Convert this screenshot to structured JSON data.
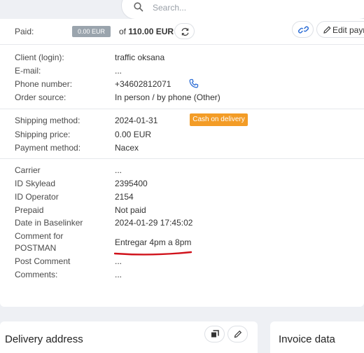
{
  "search": {
    "placeholder": "Search..."
  },
  "payment": {
    "label": "Paid:",
    "paid_amount": "0.00 EUR",
    "of_text": "of",
    "total": "110.00 EUR"
  },
  "actions": {
    "edit_label": "Edit payment"
  },
  "client": {
    "rows": [
      {
        "label": "Client (login):",
        "value": "traffic oksana"
      },
      {
        "label": "E-mail:",
        "value": "..."
      },
      {
        "label": "Phone number:",
        "value": "+34602812071"
      },
      {
        "label": "Order source:",
        "value": "In person / by phone (Other)"
      }
    ]
  },
  "shipping": {
    "rows": [
      {
        "label": "Shipping method:",
        "value": "2024-01-31"
      },
      {
        "label": "Shipping price:",
        "value": "0.00 EUR"
      },
      {
        "label": "Payment method:",
        "value": "Nacex"
      }
    ],
    "badge": "Cash on delivery"
  },
  "details": {
    "rows": [
      {
        "label": "Carrier",
        "value": "..."
      },
      {
        "label": "ID Skylead",
        "value": "2395400"
      },
      {
        "label": "ID Operator",
        "value": "2154"
      },
      {
        "label": "Prepaid",
        "value": "Not paid"
      },
      {
        "label": "Date in Baselinker",
        "value": "2024-01-29 17:45:02"
      }
    ],
    "comment_label_1": "Comment for",
    "comment_label_2": "POSTMAN",
    "comment_value": "Entregar 4pm a 8pm",
    "post_comment_label": "Post Comment",
    "post_comment_value": "...",
    "comments_label": "Comments:",
    "comments_value": "..."
  },
  "panels": {
    "delivery_title": "Delivery address",
    "invoice_title": "Invoice data"
  },
  "colors": {
    "accent": "#2f6fd6",
    "badge_orange": "#f39c26",
    "badge_grey": "#9aa4ad",
    "annotation_red": "#d0121b"
  },
  "icons": [
    "search-icon",
    "refresh-icon",
    "link-icon",
    "pencil-icon",
    "phone-icon",
    "copy-icon"
  ]
}
